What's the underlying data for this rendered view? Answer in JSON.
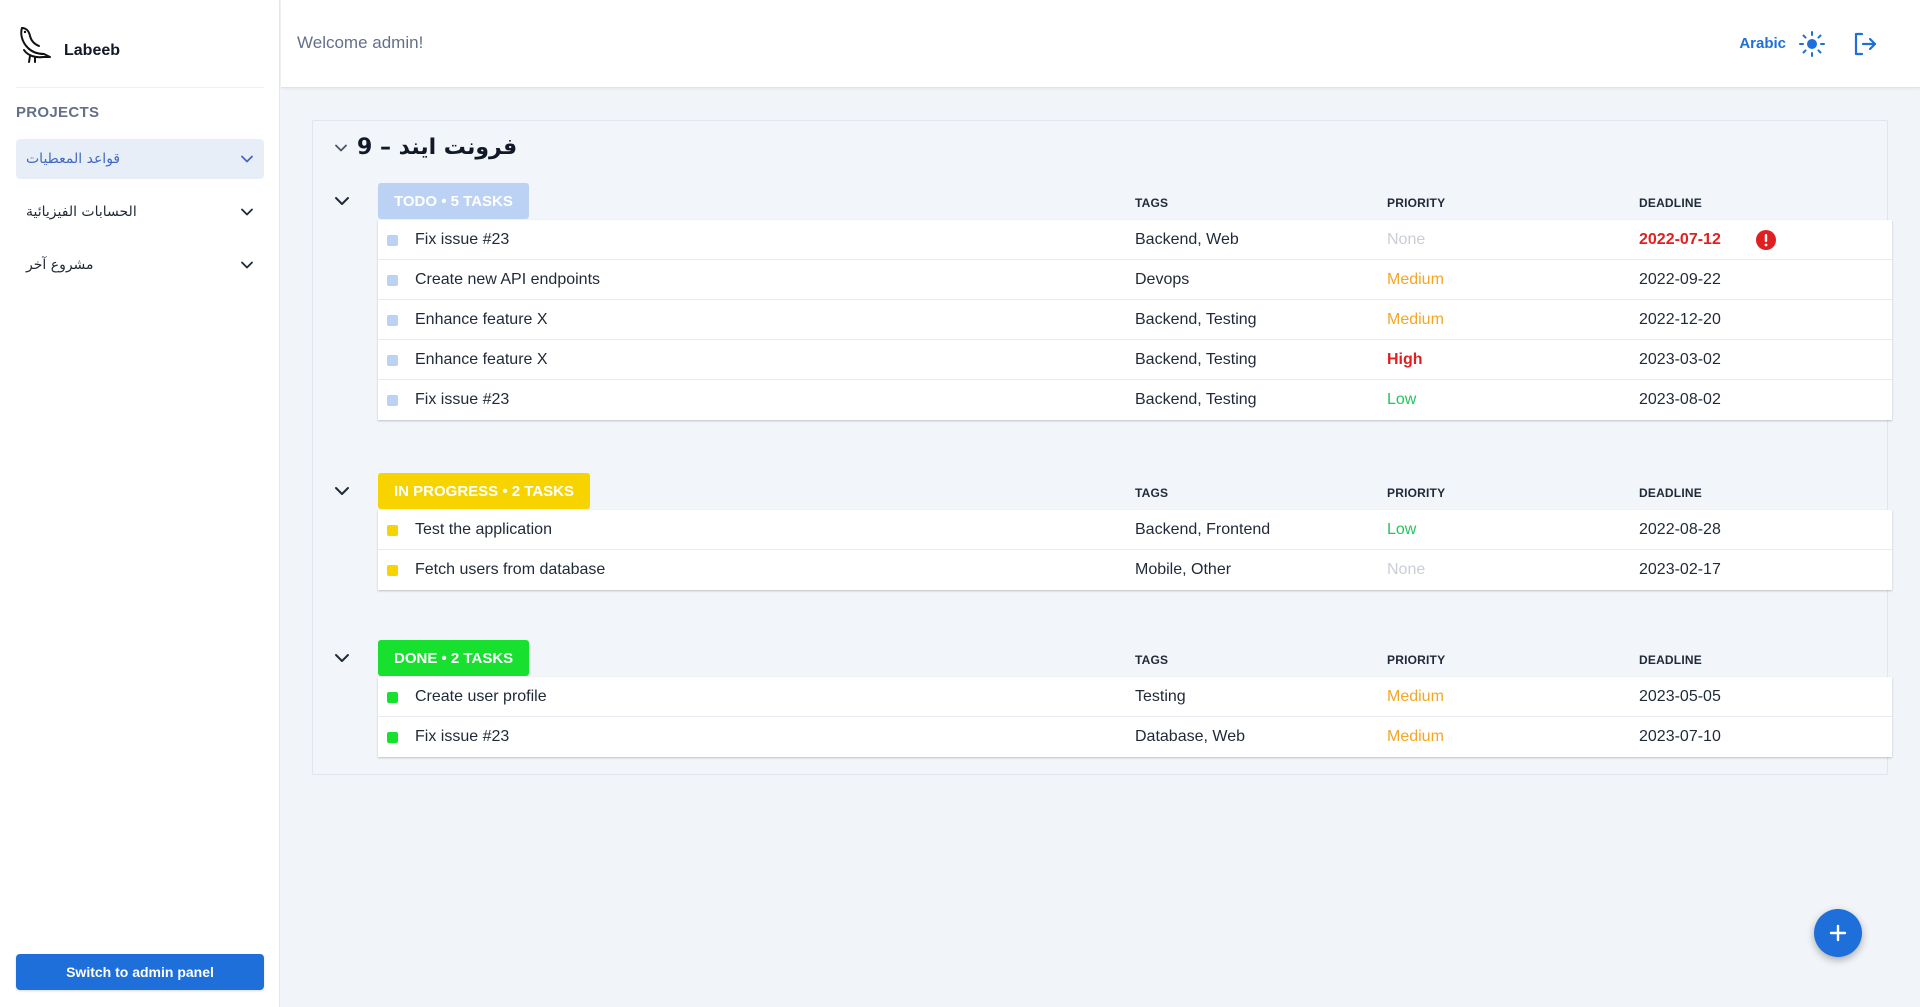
{
  "sidebar": {
    "brand_name": "Labeeb",
    "logo_icon": "bird-logo-icon",
    "projects_title": "PROJECTS",
    "projects": [
      {
        "label": "قواعد المعطيات",
        "active": true
      },
      {
        "label": "الحسابات الفيزيائية",
        "active": false
      },
      {
        "label": "مشروع آخر",
        "active": false
      }
    ],
    "admin_button": "Switch to admin panel"
  },
  "header": {
    "welcome": "Welcome admin!",
    "language": "Arabic",
    "theme_icon": "sun-icon",
    "logout_icon": "logout-icon"
  },
  "project": {
    "title": "فرونت ايند – 9"
  },
  "columns": {
    "tags": "TAGS",
    "priority": "PRIORITY",
    "deadline": "DEADLINE"
  },
  "priority_colors": {
    "None": "#c9ced6",
    "Low": "#22c55e",
    "Medium": "#f5a623",
    "High": "#e02020"
  },
  "groups": [
    {
      "label": "TODO • 5 TASKS",
      "color": "#bcd2f5",
      "tasks": [
        {
          "name": "Fix issue #23",
          "tags": "Backend, Web",
          "priority": "None",
          "deadline": "2022-07-12",
          "overdue": true
        },
        {
          "name": "Create new API endpoints",
          "tags": "Devops",
          "priority": "Medium",
          "deadline": "2022-09-22",
          "overdue": false
        },
        {
          "name": "Enhance feature X",
          "tags": "Backend, Testing",
          "priority": "Medium",
          "deadline": "2022-12-20",
          "overdue": false
        },
        {
          "name": "Enhance feature X",
          "tags": "Backend, Testing",
          "priority": "High",
          "deadline": "2023-03-02",
          "overdue": false
        },
        {
          "name": "Fix issue #23",
          "tags": "Backend, Testing",
          "priority": "Low",
          "deadline": "2023-08-02",
          "overdue": false
        }
      ]
    },
    {
      "label": "IN PROGRESS • 2 TASKS",
      "color": "#f7d400",
      "tasks": [
        {
          "name": "Test the application",
          "tags": "Backend, Frontend",
          "priority": "Low",
          "deadline": "2022-08-28",
          "overdue": false
        },
        {
          "name": "Fetch users from database",
          "tags": "Mobile, Other",
          "priority": "None",
          "deadline": "2023-02-17",
          "overdue": false
        }
      ]
    },
    {
      "label": "DONE • 2 TASKS",
      "color": "#17e02f",
      "tasks": [
        {
          "name": "Create user profile",
          "tags": "Testing",
          "priority": "Medium",
          "deadline": "2023-05-05",
          "overdue": false
        },
        {
          "name": "Fix issue #23",
          "tags": "Database, Web",
          "priority": "Medium",
          "deadline": "2023-07-10",
          "overdue": false
        }
      ]
    }
  ],
  "fab_icon": "plus-icon"
}
